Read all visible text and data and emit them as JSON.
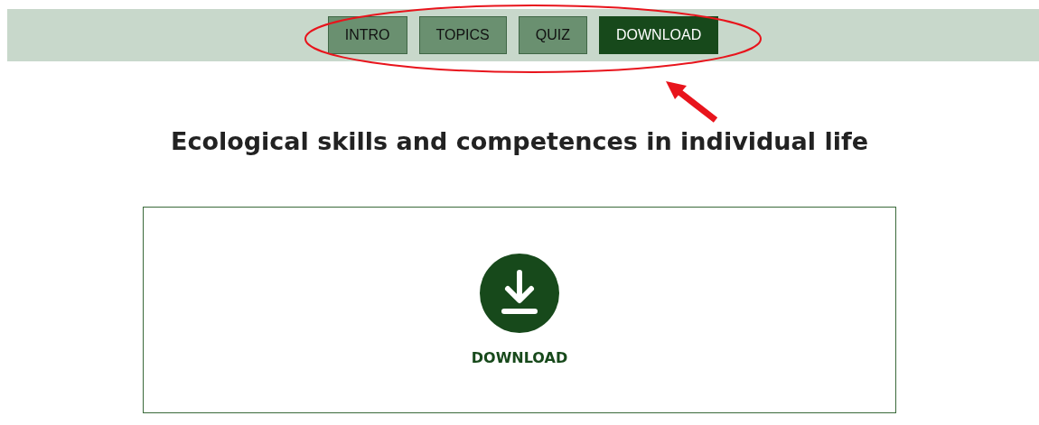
{
  "nav": {
    "tabs": [
      {
        "label": "INTRO",
        "selected": false
      },
      {
        "label": "TOPICS",
        "selected": false
      },
      {
        "label": "QUIZ",
        "selected": false
      },
      {
        "label": "DOWNLOAD",
        "selected": true
      }
    ]
  },
  "heading": "Ecological skills and competences in individual life",
  "download_card": {
    "label": "DOWNLOAD"
  }
}
